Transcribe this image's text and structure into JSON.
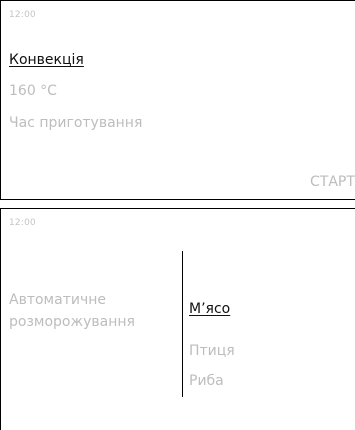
{
  "screen_1": {
    "time": "12:00",
    "mode": "Конвекція",
    "temperature": "160 °C",
    "cook_time_label": "Час приготування",
    "start_label": "СТАРТ"
  },
  "screen_2": {
    "time": "12:00",
    "program": "Автоматичне розморожування",
    "options": [
      {
        "label": "М’ясо",
        "selected": true
      },
      {
        "label": "Птиця",
        "selected": false
      },
      {
        "label": "Риба",
        "selected": false
      }
    ]
  },
  "colors": {
    "active_text": "#111111",
    "inactive_text": "#bdbdbd",
    "border": "#000000"
  }
}
